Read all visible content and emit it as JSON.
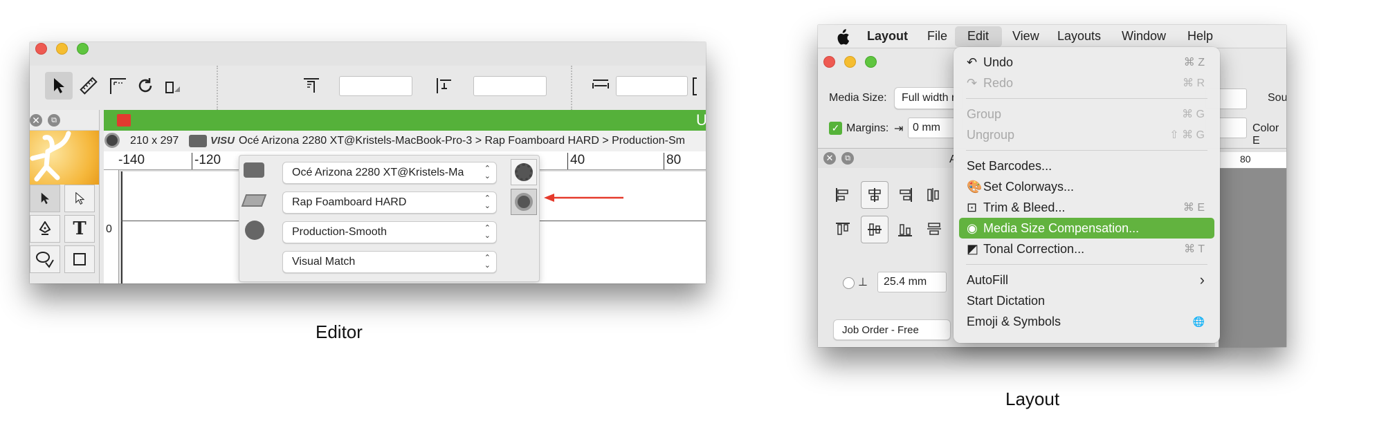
{
  "editor": {
    "caption": "Editor",
    "panel_tab_text": "U",
    "infobar": {
      "size": "210 x 297",
      "visu": "VISU",
      "path": "Océ Arizona 2280 XT@Kristels-MacBook-Pro-3 > Rap Foamboard HARD > Production-Sm"
    },
    "ruler_labels": [
      "-140",
      "-120",
      "40",
      "80"
    ],
    "vruler_label": "0",
    "selects": [
      "Océ Arizona 2280 XT@Kristels-Ma",
      "Rap Foamboard HARD",
      "Production-Smooth",
      "Visual Match"
    ],
    "arrow_color": "#e53a2c"
  },
  "layout": {
    "caption": "Layout",
    "menubar": [
      "Layout",
      "File",
      "Edit",
      "View",
      "Layouts",
      "Window",
      "Help"
    ],
    "media_size_label": "Media Size:",
    "media_size_value": "Full width r",
    "margins_label": "Margins:",
    "margins_value": "0 mm",
    "source_label": "Sou",
    "color_label": "Color E",
    "panel_title": "A",
    "ruler_label": "80",
    "spacing_value": "25.4 mm",
    "job_order": "Job Order - Free",
    "edit_menu": [
      {
        "label": "Undo",
        "shortcut": "⌘ Z"
      },
      {
        "label": "Redo",
        "shortcut": "⌘ R"
      },
      {
        "label": "Group",
        "shortcut": "⌘ G"
      },
      {
        "label": "Ungroup",
        "shortcut": "⇧ ⌘ G"
      },
      {
        "label": "Set Barcodes...",
        "shortcut": ""
      },
      {
        "label": "Set Colorways...",
        "shortcut": ""
      },
      {
        "label": "Trim & Bleed...",
        "shortcut": "⌘ E"
      },
      {
        "label": "Media Size Compensation...",
        "shortcut": ""
      },
      {
        "label": "Tonal Correction...",
        "shortcut": "⌘ T"
      },
      {
        "label": "AutoFill",
        "shortcut": "›"
      },
      {
        "label": "Start Dictation",
        "shortcut": ""
      },
      {
        "label": "Emoji & Symbols",
        "shortcut": "🌐"
      }
    ],
    "accent": "#62b33f"
  }
}
